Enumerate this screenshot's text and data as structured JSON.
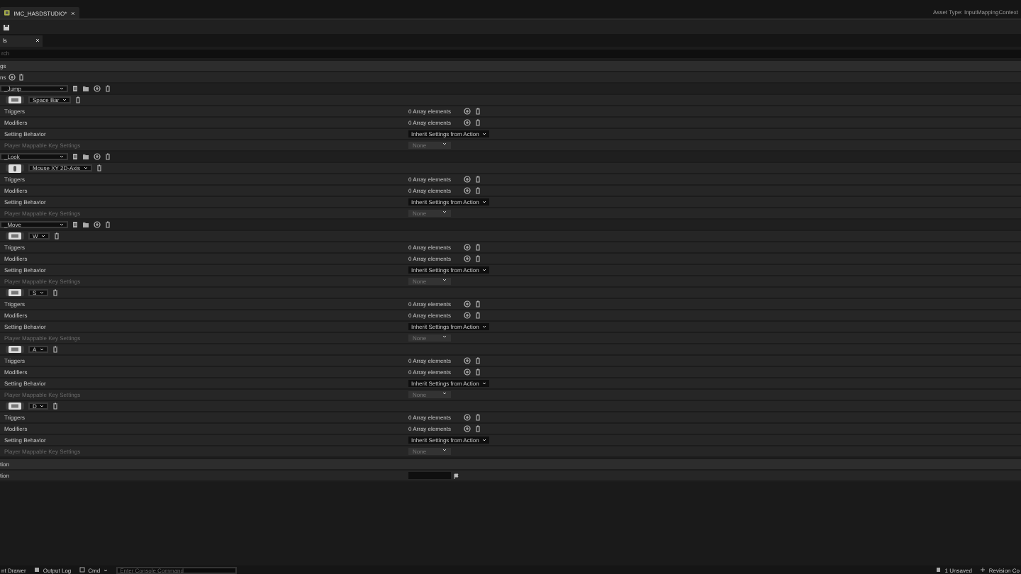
{
  "tabs": [
    {
      "label": "IMC_HASDSTUDIO*",
      "selected": true
    }
  ],
  "asset_type": "Asset Type: InputMappingContext",
  "details_tab": {
    "label": "ls"
  },
  "search": {
    "placeholder": "rch"
  },
  "section": "gs",
  "mappings_label": "ns",
  "mappings": [
    {
      "action": "_Jump",
      "keys": [
        {
          "key": "Space Bar",
          "kind": "keyboard",
          "rows": [
            {
              "label": "Triggers",
              "value": "0 Array elements",
              "kind": "array",
              "disabled": false
            },
            {
              "label": "Modifiers",
              "value": "0 Array elements",
              "kind": "array",
              "disabled": false
            },
            {
              "label": "Setting Behavior",
              "value": "Inherit Settings from Action",
              "kind": "combo",
              "disabled": false
            },
            {
              "label": "Player Mappable Key Settings",
              "value": "None",
              "kind": "select",
              "disabled": true
            }
          ]
        }
      ]
    },
    {
      "action": "_Look",
      "keys": [
        {
          "key": "Mouse XY 2D-Axis",
          "kind": "mouse",
          "rows": [
            {
              "label": "Triggers",
              "value": "0 Array elements",
              "kind": "array",
              "disabled": false
            },
            {
              "label": "Modifiers",
              "value": "0 Array elements",
              "kind": "array",
              "disabled": false
            },
            {
              "label": "Setting Behavior",
              "value": "Inherit Settings from Action",
              "kind": "combo",
              "disabled": false
            },
            {
              "label": "Player Mappable Key Settings",
              "value": "None",
              "kind": "select",
              "disabled": true
            }
          ]
        }
      ]
    },
    {
      "action": "_Move",
      "keys": [
        {
          "key": "W",
          "kind": "keyboard",
          "rows": [
            {
              "label": "Triggers",
              "value": "0 Array elements",
              "kind": "array",
              "disabled": false
            },
            {
              "label": "Modifiers",
              "value": "0 Array elements",
              "kind": "array",
              "disabled": false
            },
            {
              "label": "Setting Behavior",
              "value": "Inherit Settings from Action",
              "kind": "combo",
              "disabled": false
            },
            {
              "label": "Player Mappable Key Settings",
              "value": "None",
              "kind": "select",
              "disabled": true
            }
          ]
        },
        {
          "key": "S",
          "kind": "keyboard",
          "rows": [
            {
              "label": "Triggers",
              "value": "0 Array elements",
              "kind": "array",
              "disabled": false
            },
            {
              "label": "Modifiers",
              "value": "0 Array elements",
              "kind": "array",
              "disabled": false
            },
            {
              "label": "Setting Behavior",
              "value": "Inherit Settings from Action",
              "kind": "combo",
              "disabled": false
            },
            {
              "label": "Player Mappable Key Settings",
              "value": "None",
              "kind": "select",
              "disabled": true
            }
          ]
        },
        {
          "key": "A",
          "kind": "keyboard",
          "rows": [
            {
              "label": "Triggers",
              "value": "0 Array elements",
              "kind": "array",
              "disabled": false
            },
            {
              "label": "Modifiers",
              "value": "0 Array elements",
              "kind": "array",
              "disabled": false
            },
            {
              "label": "Setting Behavior",
              "value": "Inherit Settings from Action",
              "kind": "combo",
              "disabled": false
            },
            {
              "label": "Player Mappable Key Settings",
              "value": "None",
              "kind": "select",
              "disabled": true
            }
          ]
        },
        {
          "key": "D",
          "kind": "keyboard",
          "rows": [
            {
              "label": "Triggers",
              "value": "0 Array elements",
              "kind": "array",
              "disabled": false
            },
            {
              "label": "Modifiers",
              "value": "0 Array elements",
              "kind": "array",
              "disabled": false
            },
            {
              "label": "Setting Behavior",
              "value": "Inherit Settings from Action",
              "kind": "combo",
              "disabled": false
            },
            {
              "label": "Player Mappable Key Settings",
              "value": "None",
              "kind": "select",
              "disabled": true
            }
          ]
        }
      ]
    }
  ],
  "description": {
    "header": "tion",
    "rows": [
      {
        "label": "tion"
      }
    ]
  },
  "status_bar": {
    "items": [
      {
        "label": "nt Drawer",
        "kind": "drawer"
      },
      {
        "label": "Output Log",
        "kind": "log"
      },
      {
        "label": "Cmd",
        "kind": "cmd"
      }
    ],
    "console": {
      "placeholder": "Enter Console Command"
    },
    "right": [
      {
        "label": "1 Unsaved",
        "kind": "unsaved"
      },
      {
        "label": "Revision Co",
        "kind": "revision"
      }
    ]
  }
}
